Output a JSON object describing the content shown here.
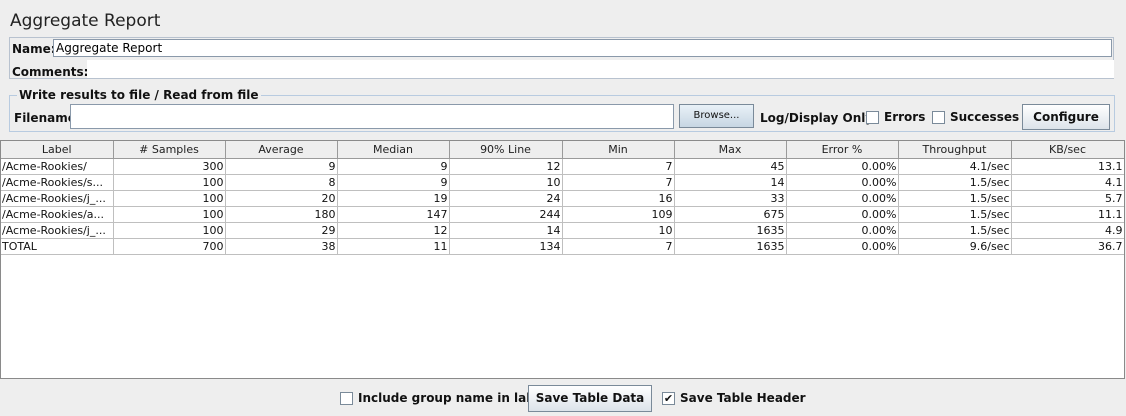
{
  "title": "Aggregate Report",
  "name_field": {
    "label": "Name:",
    "value": "Aggregate Report"
  },
  "comments": {
    "label": "Comments:"
  },
  "file_group": {
    "legend": "Write results to file / Read from file",
    "filename_label": "Filename",
    "browse_label": "Browse...",
    "log_display_label": "Log/Display Only:",
    "errors_label": "Errors",
    "successes_label": "Successes",
    "configure_label": "Configure"
  },
  "table": {
    "columns": [
      "Label",
      "# Samples",
      "Average",
      "Median",
      "90% Line",
      "Min",
      "Max",
      "Error %",
      "Throughput",
      "KB/sec"
    ],
    "rows": [
      [
        "/Acme-Rookies/",
        "300",
        "9",
        "9",
        "12",
        "7",
        "45",
        "0.00%",
        "4.1/sec",
        "13.1"
      ],
      [
        "/Acme-Rookies/s...",
        "100",
        "8",
        "9",
        "10",
        "7",
        "14",
        "0.00%",
        "1.5/sec",
        "4.1"
      ],
      [
        "/Acme-Rookies/j_...",
        "100",
        "20",
        "19",
        "24",
        "16",
        "33",
        "0.00%",
        "1.5/sec",
        "5.7"
      ],
      [
        "/Acme-Rookies/a...",
        "100",
        "180",
        "147",
        "244",
        "109",
        "675",
        "0.00%",
        "1.5/sec",
        "11.1"
      ],
      [
        "/Acme-Rookies/j_...",
        "100",
        "29",
        "12",
        "14",
        "10",
        "1635",
        "0.00%",
        "1.5/sec",
        "4.9"
      ],
      [
        "TOTAL",
        "700",
        "38",
        "11",
        "134",
        "7",
        "1635",
        "0.00%",
        "9.6/sec",
        "36.7"
      ]
    ]
  },
  "bottom": {
    "include_group_label": "Include group name in label?",
    "include_group_checked": false,
    "save_table_data_label": "Save Table Data",
    "save_header_label": "Save Table Header",
    "save_header_checked": true
  }
}
